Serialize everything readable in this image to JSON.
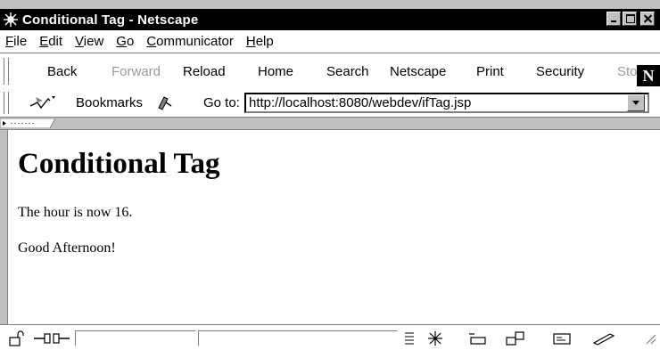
{
  "window": {
    "title": "Conditional Tag - Netscape"
  },
  "menu": [
    {
      "accel": "F",
      "rest": "ile"
    },
    {
      "accel": "E",
      "rest": "dit"
    },
    {
      "accel": "V",
      "rest": "iew"
    },
    {
      "accel": "G",
      "rest": "o"
    },
    {
      "accel": "C",
      "rest": "ommunicator"
    },
    {
      "accel": "H",
      "rest": "elp"
    }
  ],
  "toolbar": {
    "back": "Back",
    "forward": "Forward",
    "reload": "Reload",
    "home": "Home",
    "search": "Search",
    "netscape": "Netscape",
    "print": "Print",
    "security": "Security",
    "stop": "Sto",
    "logo": "N"
  },
  "location": {
    "bookmarks_label": "Bookmarks",
    "goto_label": "Go to:",
    "url": "http://localhost:8080/webdev/ifTag.jsp"
  },
  "page": {
    "heading": "Conditional Tag",
    "line1": "The hour is now 16.",
    "line2": "Good Afternoon!"
  }
}
